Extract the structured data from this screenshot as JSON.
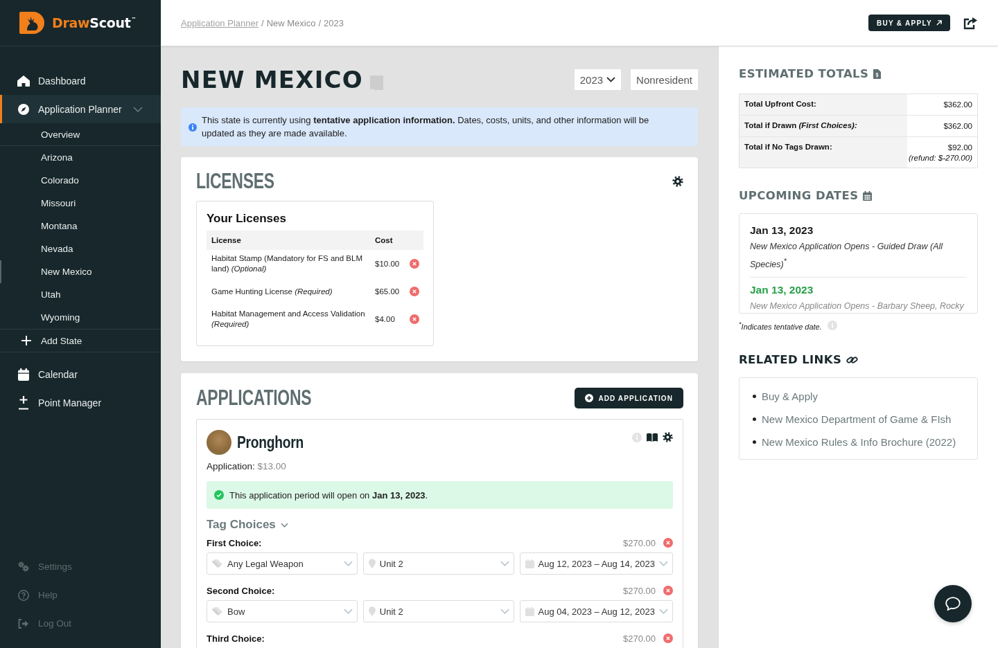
{
  "logo": {
    "name_first": "Draw",
    "name_second": "Scout",
    "trademark": "™"
  },
  "sidebar": {
    "items": [
      {
        "kind": "link",
        "label": "Dashboard",
        "selected": false
      },
      {
        "kind": "group",
        "label": "Application Planner",
        "selected": true,
        "expanded": true,
        "children": [
          {
            "label": "Overview",
            "selected": false
          },
          {
            "label": "Arizona",
            "selected": false
          },
          {
            "label": "Colorado",
            "selected": false
          },
          {
            "label": "Missouri",
            "selected": false
          },
          {
            "label": "Montana",
            "selected": false
          },
          {
            "label": "Nevada",
            "selected": false
          },
          {
            "label": "New Mexico",
            "selected": true
          },
          {
            "label": "Utah",
            "selected": false
          },
          {
            "label": "Wyoming",
            "selected": false
          }
        ],
        "add_label": "Add State"
      },
      {
        "kind": "link",
        "label": "Calendar",
        "selected": false
      },
      {
        "kind": "link",
        "label": "Point Manager",
        "selected": false
      }
    ],
    "footer_items": [
      {
        "label": "Settings"
      },
      {
        "label": "Help"
      },
      {
        "label": "Log Out"
      }
    ]
  },
  "header": {
    "breadcrumb": {
      "separator": "/",
      "items": [
        {
          "kind": "link",
          "label": "Application Planner"
        },
        {
          "kind": "text",
          "label": "New Mexico"
        },
        {
          "kind": "text",
          "label": "2023"
        }
      ]
    },
    "buy_button": "BUY & APPLY"
  },
  "page": {
    "title": "NEW MEXICO",
    "year_select": "2023",
    "residency_select": "Nonresident"
  },
  "notice": {
    "text": "This state is currently using **tentative application information.** Dates, costs, units, and other information will be updated as they are made available."
  },
  "licenses": {
    "title": "LICENSES",
    "subtitle": "Your Licenses",
    "columns": [
      "License",
      "Cost"
    ],
    "rows": [
      {
        "name": "Habitat Stamp (Mandatory for FS and BLM land) *(Optional)*",
        "cost": "$10.00"
      },
      {
        "name": "Game Hunting License *(Required)*",
        "cost": "$65.00"
      },
      {
        "name": "Habitat Management and Access Validation *(Required)*",
        "cost": "$4.00"
      }
    ]
  },
  "applications": {
    "title": "APPLICATIONS",
    "add_button": "ADD APPLICATION",
    "items": [
      {
        "species": "Pronghorn",
        "fee_label": "Application:",
        "fee": "$13.00",
        "status": "This application period will open on **Jan 13, 2023**.",
        "tag_choices": {
          "title": "Tag Choices",
          "expanded": true,
          "choices": [
            {
              "label": "First Choice:",
              "cost": "$270.00",
              "weapon": "Any Legal Weapon",
              "unit": "Unit 2",
              "dates": "Aug 12, 2023 – Aug 14, 2023"
            },
            {
              "label": "Second Choice:",
              "cost": "$270.00",
              "weapon": "Bow",
              "unit": "Unit 2",
              "dates": "Aug 04, 2023 – Aug 12, 2023"
            },
            {
              "label": "Third Choice:",
              "cost": "$270.00"
            }
          ]
        }
      }
    ]
  },
  "totals": {
    "title": "ESTIMATED TOTALS",
    "rows": [
      {
        "label": "Total Upfront Cost:",
        "value": "$362.00"
      },
      {
        "label": "Total if Drawn *(First Choices):*",
        "value": "$362.00"
      },
      {
        "label": "Total if No Tags Drawn:",
        "value": "$92.00",
        "note": "(refund: $-270.00)"
      }
    ]
  },
  "upcoming_dates": {
    "title": "UPCOMING DATES",
    "items": [
      {
        "date": "Jan 13, 2023",
        "color": "#1b1b1b",
        "description": "New Mexico Application Opens - Guided Draw (All Species)$^{*}$"
      },
      {
        "date": "Jan 13, 2023",
        "color": "#27a048",
        "description": "New Mexico Application Opens - Barbary Sheep, Rocky"
      }
    ],
    "footnote": "$^{*}$Indicates tentative date."
  },
  "related_links": {
    "title": "RELATED LINKS",
    "items": [
      "Buy & Apply",
      "New Mexico Department of Game & FIsh",
      "New Mexico Rules & Info Brochure (2022)"
    ]
  }
}
